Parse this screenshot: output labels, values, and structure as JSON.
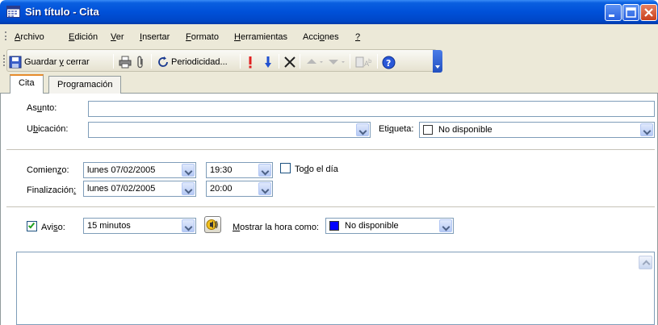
{
  "window": {
    "title": "Sin título - Cita",
    "app_icon": "calendar-icon",
    "controls": [
      "minimize-icon",
      "maximize-icon",
      "close-icon"
    ]
  },
  "menubar": {
    "items": [
      {
        "label": "Archivo",
        "accel": "A",
        "rest": "rchivo"
      },
      {
        "label": "Edición",
        "accel": "E",
        "rest": "dición"
      },
      {
        "label": "Ver",
        "accel": "V",
        "rest": "er"
      },
      {
        "label": "Insertar",
        "accel": "I",
        "rest": "nsertar"
      },
      {
        "label": "Formato",
        "accel": "F",
        "rest": "ormato"
      },
      {
        "label": "Herramientas",
        "accel": "H",
        "rest": "erramientas"
      },
      {
        "label": "Acciones",
        "pre": "Acci",
        "accel": "o",
        "rest": "nes"
      },
      {
        "label": "?",
        "accel": "?",
        "rest": ""
      }
    ]
  },
  "toolbar": {
    "save_close": {
      "pre": "Guardar ",
      "accel": "y",
      "post": " cerrar"
    },
    "recurrence": {
      "pre": "Periodicidad",
      "accel": "",
      "post": "..."
    }
  },
  "tabs": [
    {
      "label": "Cita",
      "active": true
    },
    {
      "label": "Programación",
      "active": false
    }
  ],
  "form": {
    "subject": {
      "label_pre": "As",
      "label_accel": "u",
      "label_post": "nto:",
      "value": ""
    },
    "location": {
      "label_pre": "U",
      "label_accel": "b",
      "label_post": "icación:",
      "value": ""
    },
    "label_field": {
      "label_pre": "Eti",
      "label_accel": "q",
      "label_post": "ueta:",
      "value": "No disponible"
    },
    "start": {
      "label_pre": "Comien",
      "label_accel": "z",
      "label_post": "o:",
      "date": "lunes 07/02/2005",
      "time": "19:30"
    },
    "end": {
      "label_pre": "Finalización",
      "label_accel": "",
      "label_post": ":",
      "date": "lunes 07/02/2005",
      "time": "20:00"
    },
    "all_day": {
      "label_pre": "To",
      "label_accel": "d",
      "label_post": "o el día",
      "checked": false
    },
    "reminder": {
      "label_pre": "Avi",
      "label_accel": "s",
      "label_post": "o:",
      "checked": true,
      "value": "15 minutos"
    },
    "show_time_as": {
      "label_pre": "",
      "label_accel": "M",
      "label_post": "ostrar la hora como:",
      "value": "No disponible",
      "color": "#0000ff"
    }
  }
}
